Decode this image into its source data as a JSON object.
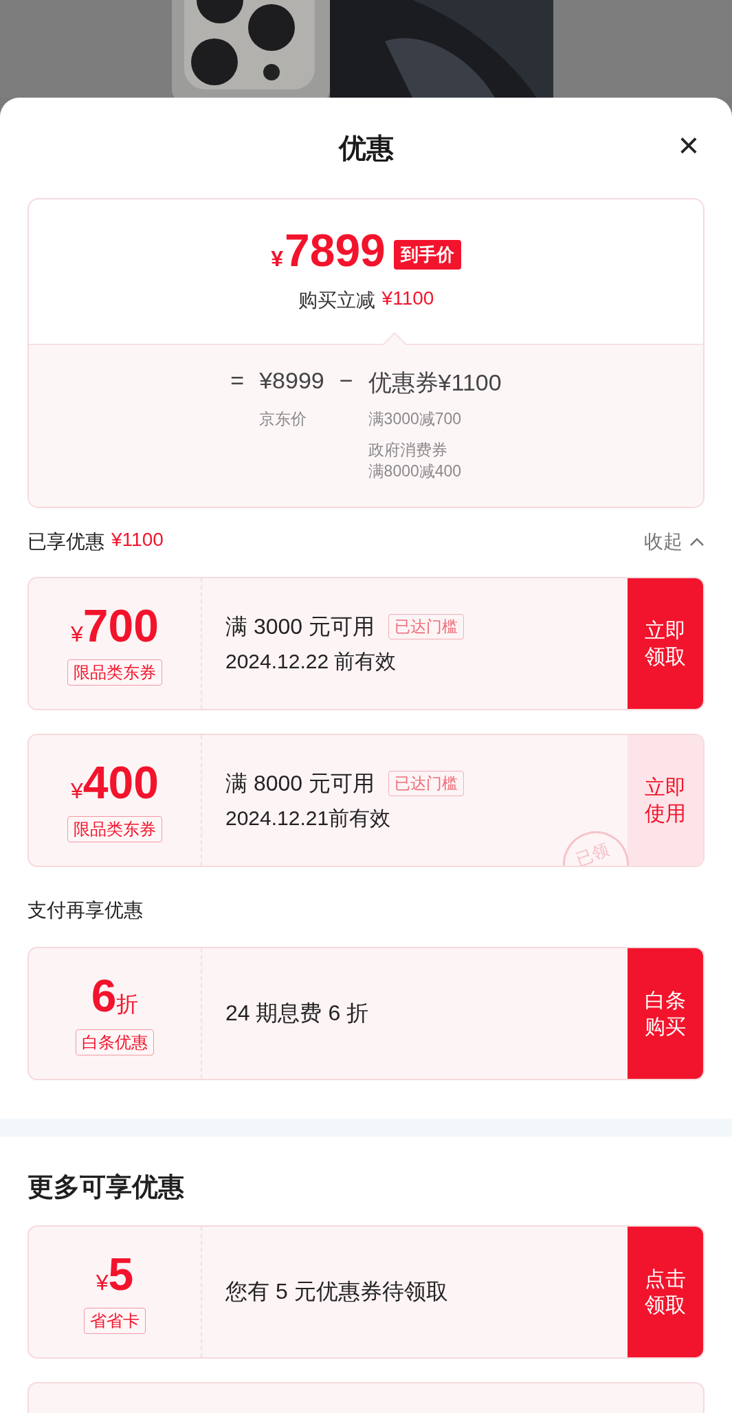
{
  "sheet": {
    "title": "优惠",
    "close": "×"
  },
  "price_card": {
    "currency": "¥",
    "final_price": "7899",
    "final_tag": "到手价",
    "saving_label": "购买立减",
    "saving_amount": "¥1100",
    "formula": {
      "equals": "=",
      "base_price": "¥8999",
      "base_label": "京东价",
      "minus": "−",
      "discount_label": "优惠券",
      "discount_amount": "¥1100",
      "discount_notes": [
        [
          "满3000减700"
        ],
        [
          "政府消费券",
          "满8000减400"
        ]
      ]
    }
  },
  "enjoyed": {
    "label": "已享优惠",
    "amount": "¥1100",
    "toggle": "收起",
    "expanded": true
  },
  "enjoyed_coupons": [
    {
      "prefix": "¥",
      "value": "700",
      "type": "限品类东券",
      "condition": "满 3000 元可用",
      "badge": "已达门槛",
      "validity": "2024.12.22 前有效",
      "action": "立即领取",
      "action_filled": true
    },
    {
      "prefix": "¥",
      "value": "400",
      "type": "限品类东券",
      "condition": "满 8000 元可用",
      "badge": "已达门槛",
      "validity": "2024.12.21前有效",
      "action": "立即使用",
      "action_filled": false,
      "stamp": "已领"
    }
  ],
  "payment": {
    "title": "支付再享优惠",
    "coupons": [
      {
        "value": "6",
        "suffix": "折",
        "type": "白条优惠",
        "condition": "24 期息费 6 折",
        "action": "白条购买",
        "action_filled": true
      }
    ]
  },
  "more": {
    "title": "更多可享优惠",
    "coupons": [
      {
        "prefix": "¥",
        "value": "5",
        "type": "省省卡",
        "condition": "您有 5 元优惠券待领取",
        "action": "点击领取",
        "action_filled": true
      }
    ]
  }
}
